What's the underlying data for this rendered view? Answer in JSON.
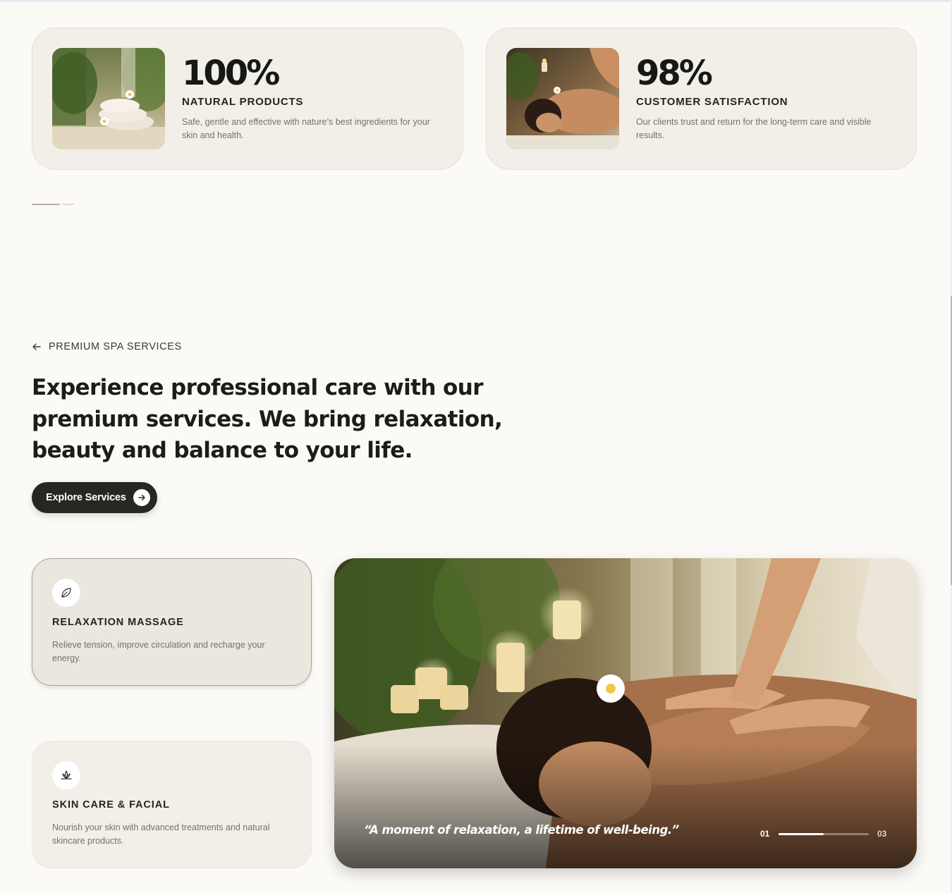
{
  "stats": [
    {
      "value": "100%",
      "label": "NATURAL PRODUCTS",
      "description": "Safe, gentle and effective with nature’s best ingredients for your skin and health.",
      "image": "towels-and-flowers-photo"
    },
    {
      "value": "98%",
      "label": "CUSTOMER SATISFACTION",
      "description": "Our clients trust and return for the long-term care and visible results.",
      "image": "massage-client-photo"
    }
  ],
  "services_intro": {
    "eyebrow": "PREMIUM SPA SERVICES",
    "eyebrow_icon": "arrow-left-icon",
    "headline": "Experience professional care with our premium services. We bring relaxation, beauty and balance to your life.",
    "cta_label": "Explore Services",
    "cta_icon": "arrow-right-circle-icon"
  },
  "services": [
    {
      "title": "RELAXATION MASSAGE",
      "description": "Relieve tension, improve circulation and recharge your energy.",
      "icon": "leaf-icon"
    },
    {
      "title": "SKIN CARE & FACIAL",
      "description": "Nourish your skin with advanced treatments and natural skincare products.",
      "icon": "lotus-icon"
    }
  ],
  "hero": {
    "quote": "“A moment of relaxation, a lifetime of well-being.”",
    "current_slide": "01",
    "total_slides": "03",
    "progress": 0.5
  },
  "colors": {
    "background": "#fcfaf7",
    "card": "#f2efe8",
    "button": "#252822",
    "text_dark": "#1c1c18",
    "text_muted": "#76716a"
  }
}
